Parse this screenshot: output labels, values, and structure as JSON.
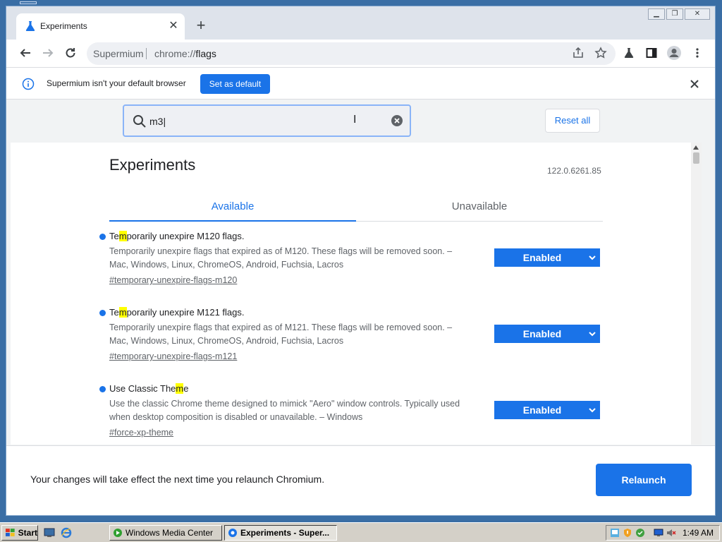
{
  "browser": {
    "tab_title": "Experiments",
    "omnibox_site": "Supermium",
    "omnibox_url_scheme": "chrome://",
    "omnibox_url_path": "flags"
  },
  "infobar": {
    "text": "Supermium isn't your default browser",
    "button": "Set as default"
  },
  "search": {
    "value": "m3",
    "reset_label": "Reset all"
  },
  "page": {
    "title": "Experiments",
    "version": "122.0.6261.85",
    "tab_available": "Available",
    "tab_unavailable": "Unavailable"
  },
  "flags": [
    {
      "name_pre": "Te",
      "name_hl": "m",
      "name_post": "porarily unexpire M120 flags.",
      "desc_line1": "Temporarily unexpire flags that expired as of M120. These flags will be removed soon. –",
      "desc_line2": "Mac, Windows, Linux, ChromeOS, Android, Fuchsia, Lacros",
      "link": "#temporary-unexpire-flags-m120",
      "value": "Enabled"
    },
    {
      "name_pre": "Te",
      "name_hl": "m",
      "name_post": "porarily unexpire M121 flags.",
      "desc_line1": "Temporarily unexpire flags that expired as of M121. These flags will be removed soon. –",
      "desc_line2": "Mac, Windows, Linux, ChromeOS, Android, Fuchsia, Lacros",
      "link": "#temporary-unexpire-flags-m121",
      "value": "Enabled"
    },
    {
      "name_pre": "Use Classic The",
      "name_hl": "m",
      "name_post": "e",
      "desc_line1": "Use the classic Chrome theme designed to mimick \"Aero\" window controls. Typically used",
      "desc_line2": "when desktop composition is disabled or unavailable. – Windows",
      "link": "#force-xp-theme",
      "value": "Enabled"
    }
  ],
  "relaunch": {
    "text": "Your changes will take effect the next time you relaunch Chromium.",
    "button": "Relaunch"
  },
  "taskbar": {
    "start": "Start",
    "task1": "Windows Media Center",
    "task2": "Experiments - Super...",
    "clock": "1:49 AM"
  },
  "colors": {
    "accent": "#1a73e8",
    "highlight": "#ffff00",
    "taskbar": "#d4d0c8"
  }
}
